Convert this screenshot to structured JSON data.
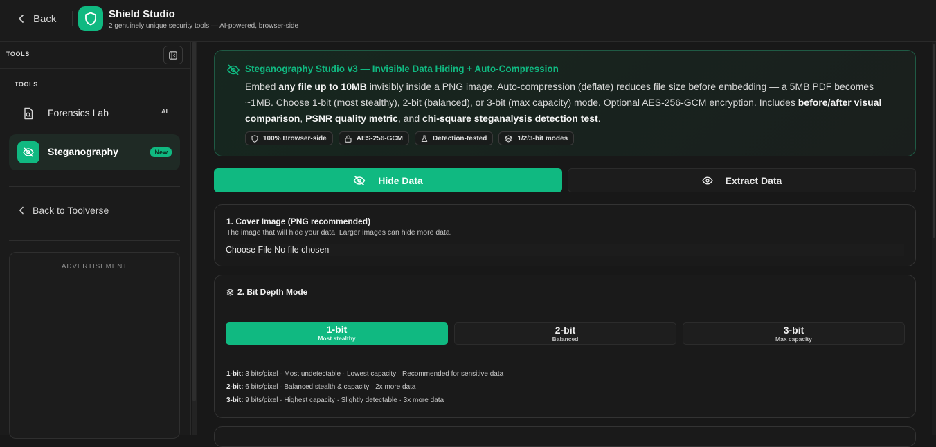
{
  "header": {
    "back_label": "Back",
    "title": "Shield Studio",
    "subtitle": "2 genuinely unique security tools — AI-powered, browser-side"
  },
  "sidebar": {
    "head_label": "TOOLS",
    "section_label": "TOOLS",
    "items": [
      {
        "label": "Forensics Lab",
        "badge": "AI",
        "icon": "file-search-icon",
        "active": false
      },
      {
        "label": "Steganography",
        "badge": "New",
        "icon": "eye-off-icon",
        "active": true
      }
    ],
    "back_link": "Back to Toolverse",
    "ad_label": "ADVERTISEMENT"
  },
  "intro": {
    "title": "Steganography Studio v3 — Invisible Data Hiding + Auto-Compression",
    "desc": {
      "p1": "Embed ",
      "b1": "any file up to 10MB",
      "p2": " invisibly inside a PNG image. Auto-compression (deflate) reduces file size before embedding — a 5MB PDF becomes ~1MB. Choose 1-bit (most stealthy), 2-bit (balanced), or 3-bit (max capacity) mode. Optional AES-256-GCM encryption. Includes ",
      "b2": "before/after visual comparison",
      "p3": ", ",
      "b3": "PSNR quality metric",
      "p4": ", and ",
      "b4": "chi-square steganalysis detection test",
      "p5": "."
    },
    "chips": [
      {
        "label": "100% Browser-side",
        "icon": "shield-icon"
      },
      {
        "label": "AES-256-GCM",
        "icon": "lock-icon"
      },
      {
        "label": "Detection-tested",
        "icon": "flask-icon"
      },
      {
        "label": "1/2/3-bit modes",
        "icon": "layers-icon"
      }
    ]
  },
  "tabs": {
    "hide": "Hide Data",
    "extract": "Extract Data",
    "active": "hide"
  },
  "cover": {
    "title": "1. Cover Image (PNG recommended)",
    "subtitle": "The image that will hide your data. Larger images can hide more data.",
    "file_input": "Choose File No file chosen"
  },
  "bitdepth": {
    "title": "2. Bit Depth Mode",
    "modes": [
      {
        "label": "1-bit",
        "sub": "Most stealthy",
        "selected": true
      },
      {
        "label": "2-bit",
        "sub": "Balanced",
        "selected": false
      },
      {
        "label": "3-bit",
        "sub": "Max capacity",
        "selected": false
      }
    ],
    "descriptions": [
      {
        "key": "1-bit:",
        "text": " 3 bits/pixel · Most undetectable · Lowest capacity · Recommended for sensitive data"
      },
      {
        "key": "2-bit:",
        "text": " 6 bits/pixel · Balanced stealth & capacity · 2x more data"
      },
      {
        "key": "3-bit:",
        "text": " 9 bits/pixel · Highest capacity · Slightly detectable · 3x more data"
      }
    ]
  },
  "colors": {
    "accent": "#10b981",
    "background": "#181818",
    "card": "#1a1a1a"
  }
}
